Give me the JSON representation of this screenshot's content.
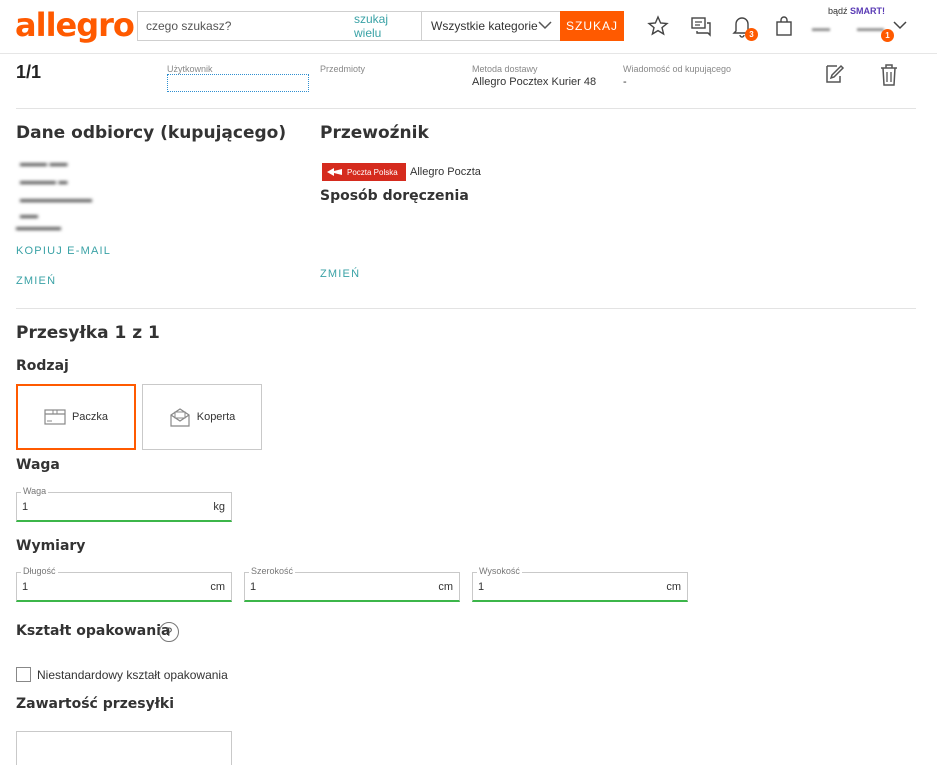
{
  "header": {
    "logo": "allegro",
    "search_placeholder": "czego szukasz?",
    "search_many": "szukaj wielu",
    "category": "Wszystkie kategorie",
    "search_button": "SZUKAJ",
    "notifications_badge": "3",
    "account_badge": "1",
    "smart_prefix": "bądź",
    "smart_brand": "SMART!",
    "accent": "#ff5a00"
  },
  "summary": {
    "count": "1/1",
    "user_label": "Użytkownik",
    "items_label": "Przedmioty",
    "delivery_label": "Metoda dostawy",
    "delivery_value": "Allegro Pocztex Kurier 48",
    "message_label": "Wiadomość od kupującego",
    "message_value": "-"
  },
  "recipient": {
    "title": "Dane odbiorcy (kupującego)",
    "copy_email": "KOPIUJ E-MAIL",
    "change": "ZMIEŃ"
  },
  "carrier": {
    "title": "Przewoźnik",
    "logo_text": "Poczta Polska",
    "name": "Allegro Poczta",
    "method_title": "Sposób doręczenia",
    "change": "ZMIEŃ"
  },
  "shipment": {
    "title": "Przesyłka 1 z 1",
    "type_title": "Rodzaj",
    "types": [
      {
        "label": "Paczka",
        "selected": true
      },
      {
        "label": "Koperta",
        "selected": false
      }
    ],
    "weight_title": "Waga",
    "weight": {
      "label": "Waga",
      "value": "1",
      "unit": "kg"
    },
    "dims_title": "Wymiary",
    "dims": [
      {
        "label": "Długość",
        "value": "1",
        "unit": "cm"
      },
      {
        "label": "Szerokość",
        "value": "1",
        "unit": "cm"
      },
      {
        "label": "Wysokość",
        "value": "1",
        "unit": "cm"
      }
    ],
    "shape_title": "Kształt opakowania",
    "help_symbol": "?",
    "nonstandard_label": "Niestandardowy kształt opakowania",
    "contents_title": "Zawartość przesyłki"
  }
}
